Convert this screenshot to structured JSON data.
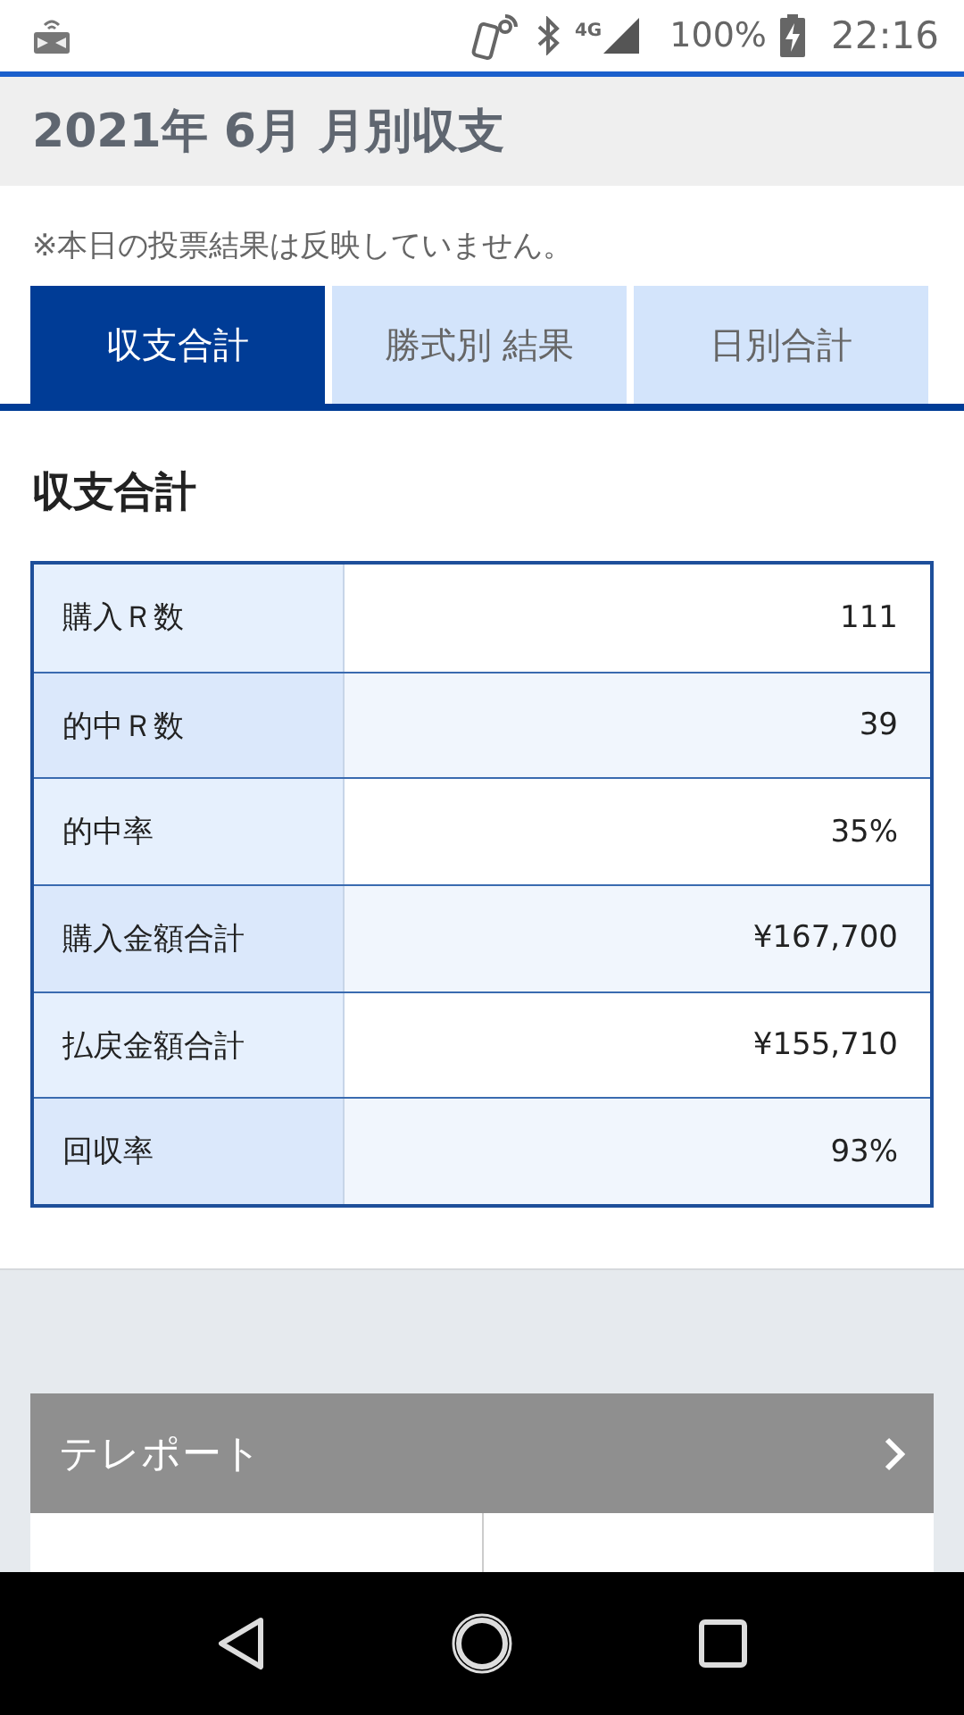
{
  "status_bar": {
    "network": "4G",
    "battery": "100%",
    "time": "22:16"
  },
  "header": {
    "title": "2021年 6月 月別収支"
  },
  "note": "※本日の投票結果は反映していません。",
  "tabs": [
    {
      "label": "収支合計",
      "selected": true
    },
    {
      "label": "勝式別 結果",
      "selected": false
    },
    {
      "label": "日別合計",
      "selected": false
    }
  ],
  "section": {
    "title": "収支合計"
  },
  "table": {
    "rows": [
      {
        "label": "購入Ｒ数",
        "value": "111"
      },
      {
        "label": "的中Ｒ数",
        "value": "39"
      },
      {
        "label": "的中率",
        "value": "35%"
      },
      {
        "label": "購入金額合計",
        "value": "¥167,700"
      },
      {
        "label": "払戻金額合計",
        "value": "¥155,710"
      },
      {
        "label": "回収率",
        "value": "93%"
      }
    ]
  },
  "link_bar": {
    "label": "テレポート"
  }
}
